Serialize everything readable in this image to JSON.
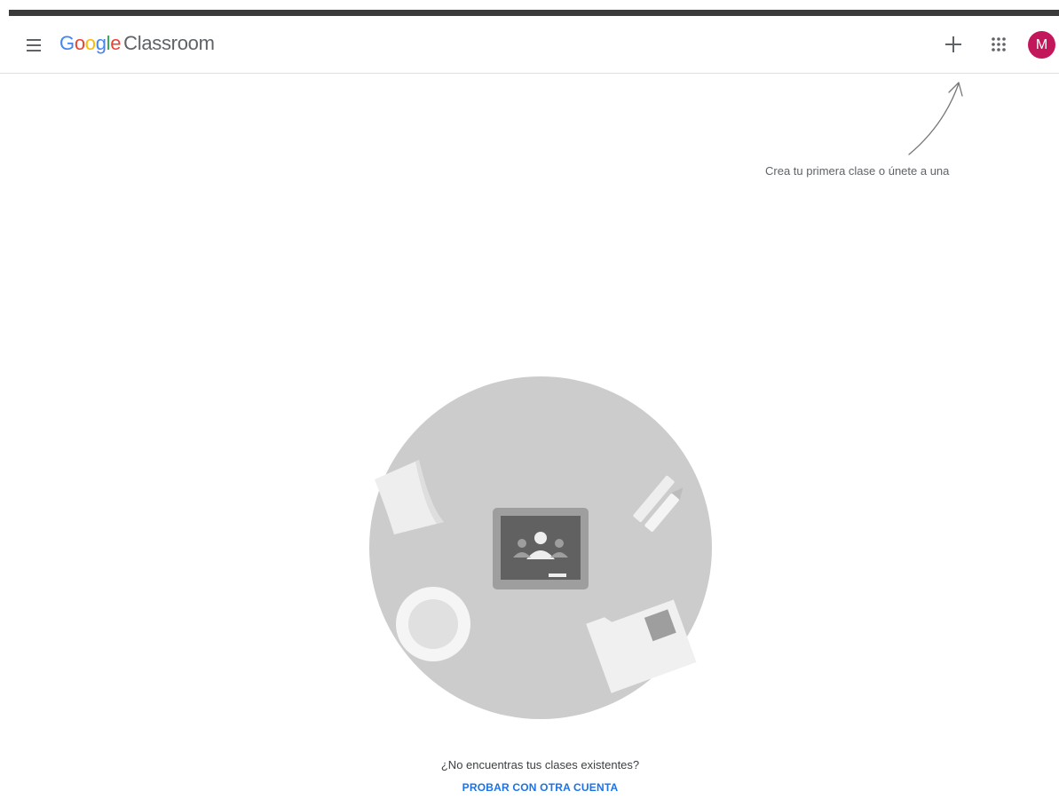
{
  "header": {
    "brand_google": [
      "G",
      "o",
      "o",
      "g",
      "l",
      "e"
    ],
    "brand_colors": [
      "#4285f4",
      "#ea4335",
      "#fbbc05",
      "#4285f4",
      "#34a853",
      "#ea4335"
    ],
    "product_name": "Classroom",
    "menu_icon": "hamburger-menu-icon",
    "create_icon": "plus-icon",
    "apps_icon": "apps-grid-icon",
    "avatar_initial": "M",
    "avatar_color": "#c2185b"
  },
  "hint": {
    "text": "Crea tu primera clase o únete a una",
    "icon": "hand-drawn-arrow-icon"
  },
  "empty_state": {
    "illustration": "classroom-table-illustration",
    "question": "¿No encuentras tus clases existentes?",
    "action_label": "PROBAR CON OTRA CUENTA",
    "action_color": "#1a73e8"
  }
}
